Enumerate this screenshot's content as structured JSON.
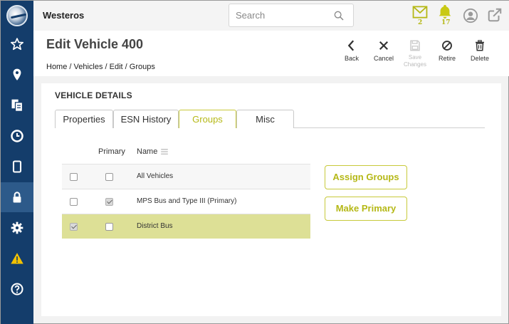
{
  "app": {
    "title": "Westeros"
  },
  "search": {
    "placeholder": "Search",
    "value": ""
  },
  "notifications": {
    "messages_count": "2",
    "alerts_count": "17"
  },
  "page": {
    "title": "Edit Vehicle 400",
    "breadcrumb": "Home / Vehicles / Edit / Groups"
  },
  "toolbar": {
    "back_label": "Back",
    "cancel_label": "Cancel",
    "save_label_1": "Save",
    "save_label_2": "Changes",
    "retire_label": "Retire",
    "delete_label": "Delete"
  },
  "section": {
    "title": "VEHICLE DETAILS"
  },
  "tabs": [
    {
      "label": "Properties",
      "active": false
    },
    {
      "label": "ESN History",
      "active": false
    },
    {
      "label": "Groups",
      "active": true
    },
    {
      "label": "Misc",
      "active": false
    }
  ],
  "table": {
    "columns": {
      "primary": "Primary",
      "name": "Name"
    },
    "rows": [
      {
        "name": "All Vehicles",
        "selected": false,
        "primary": false
      },
      {
        "name": "MPS Bus and Type III (Primary)",
        "selected": false,
        "primary": true
      },
      {
        "name": "District Bus",
        "selected": true,
        "primary": false
      }
    ]
  },
  "actions": {
    "assign_label": "Assign Groups",
    "make_primary_label": "Make Primary"
  },
  "sidebar": {
    "items": [
      {
        "icon": "star-icon"
      },
      {
        "icon": "map-pin-icon"
      },
      {
        "icon": "documents-icon"
      },
      {
        "icon": "clock-icon"
      },
      {
        "icon": "tablet-icon"
      },
      {
        "icon": "lock-icon",
        "active": true
      },
      {
        "icon": "gear-icon"
      },
      {
        "icon": "warning-icon"
      },
      {
        "icon": "help-icon"
      }
    ]
  },
  "colors": {
    "accent": "#b5b816",
    "sidebar": "#143d6b",
    "selected_row": "#dde096"
  }
}
